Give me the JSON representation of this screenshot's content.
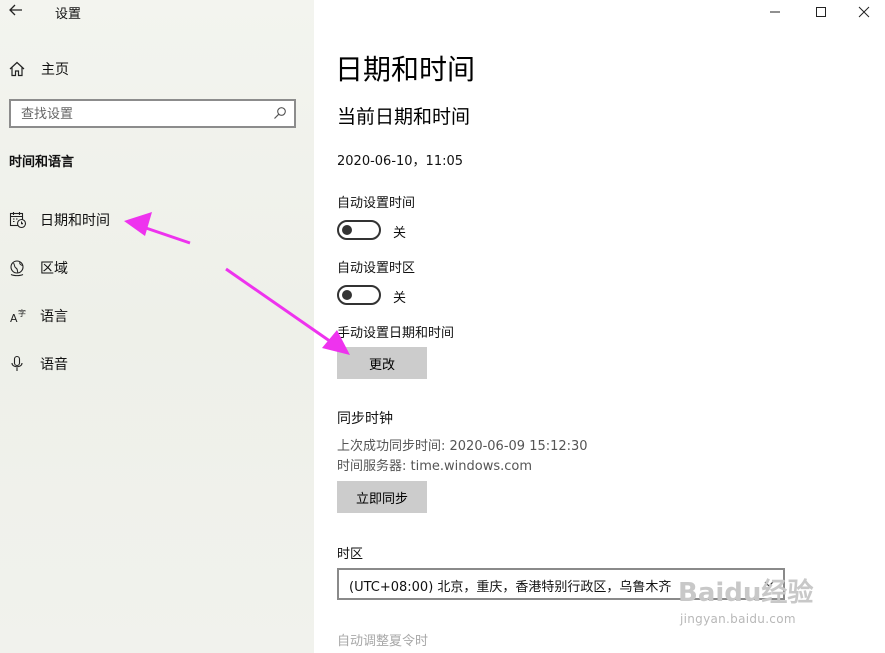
{
  "window": {
    "title": "设置"
  },
  "sidebar": {
    "home_label": "主页",
    "search_placeholder": "查找设置",
    "section_title": "时间和语言",
    "items": [
      {
        "label": "日期和时间",
        "icon": "calendar-clock-icon"
      },
      {
        "label": "区域",
        "icon": "globe-icon"
      },
      {
        "label": "语言",
        "icon": "language-icon"
      },
      {
        "label": "语音",
        "icon": "microphone-icon"
      }
    ]
  },
  "main": {
    "title": "日期和时间",
    "subtitle": "当前日期和时间",
    "current_datetime": "2020-06-10，11:05",
    "auto_time": {
      "label": "自动设置时间",
      "state": "关"
    },
    "auto_timezone": {
      "label": "自动设置时区",
      "state": "关"
    },
    "manual": {
      "label": "手动设置日期和时间",
      "button": "更改"
    },
    "sync": {
      "title": "同步时钟",
      "last_sync": "上次成功同步时间: 2020-06-09 15:12:30",
      "server": "时间服务器: time.windows.com",
      "button": "立即同步"
    },
    "timezone": {
      "label": "时区",
      "value": "(UTC+08:00) 北京，重庆，香港特别行政区，乌鲁木齐"
    },
    "dst_label": "自动调整夏令时"
  },
  "watermark": {
    "logo": "Baidu经验",
    "url": "jingyan.baidu.com"
  },
  "colors": {
    "annotation_arrow": "#ee33ee",
    "button_bg": "#cccccc",
    "sidebar_bg": "#f1f2ed"
  }
}
